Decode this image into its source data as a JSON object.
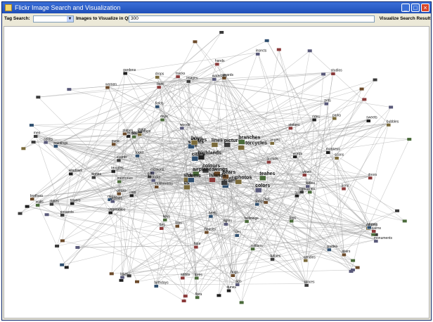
{
  "window": {
    "title": "Flickr Image Search and Visualization"
  },
  "toolbar": {
    "tag_search_label": "Tag Search:",
    "tag_search_value": "",
    "qbe_label": "Images to Visualize in QBE:",
    "qbe_value": "300",
    "visualize_button": "Visualize Search Result"
  },
  "graph": {
    "tags": [
      "bones",
      "huts",
      "metro",
      "models",
      "flowers",
      "artists",
      "highlands",
      "missions",
      "stones",
      "guns",
      "chairs",
      "bubbles",
      "tags",
      "orchids",
      "vegetables",
      "woods",
      "places",
      "mushrooms",
      "rocks",
      "candles",
      "keys",
      "cairns",
      "dunes",
      "bricks",
      "mars",
      "awards",
      "shops",
      "sha",
      "lines",
      "bars",
      "words",
      "glasses",
      "presents",
      "peaks",
      "heels",
      "lines",
      "trees",
      "studios",
      "sweets",
      "waterfalls",
      "colours",
      "trips",
      "tiles",
      "drops",
      "flora",
      "views",
      "renditions",
      "monuments",
      "states",
      "planes",
      "parties",
      "angels",
      "teahes",
      "tracks",
      "gardens",
      "sigs",
      "sports",
      "bears",
      "paintings",
      "motorcycles",
      "airplanes",
      "fairs",
      "tulips",
      "lights",
      "pictures",
      "wings",
      "cities",
      "us",
      "memories",
      "doors",
      "towers",
      "lakes",
      "images",
      "houses",
      "streets",
      "photos",
      "buildings",
      "lions",
      "cats",
      "spirits",
      "events",
      "stairs",
      "fields",
      "parks",
      "walls",
      "statues",
      "windows",
      "insects",
      "men",
      "women",
      "dams",
      "scans",
      "days",
      "hands",
      "temples",
      "pets",
      "tigers",
      "brothers",
      "sisters",
      "boys",
      "soldiers",
      "islands",
      "monkeys",
      "ladies",
      "babies",
      "bugs",
      "birthdays",
      "holidays",
      "branches",
      "ties",
      "rides",
      "colors",
      "gifts"
    ]
  }
}
